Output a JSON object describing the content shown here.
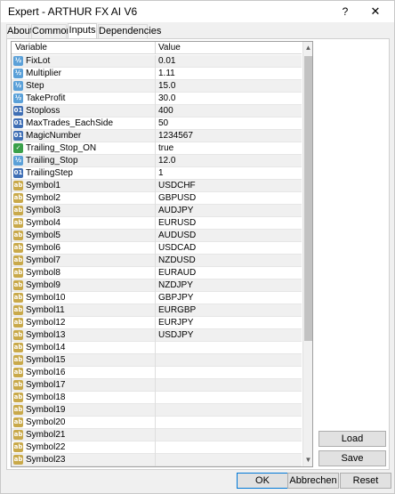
{
  "window": {
    "title": "Expert - ARTHUR FX AI V6",
    "help": "?",
    "close": "✕"
  },
  "tabs": [
    {
      "label": "About",
      "active": false
    },
    {
      "label": "Common",
      "active": false
    },
    {
      "label": "Inputs",
      "active": true
    },
    {
      "label": "Dependencies",
      "active": false
    }
  ],
  "grid": {
    "header_variable": "Variable",
    "header_value": "Value",
    "rows": [
      {
        "name": "FixLot",
        "value": "0.01",
        "type": "double"
      },
      {
        "name": "Multiplier",
        "value": "1.11",
        "type": "double"
      },
      {
        "name": "Step",
        "value": "15.0",
        "type": "double"
      },
      {
        "name": "TakeProfit",
        "value": "30.0",
        "type": "double"
      },
      {
        "name": "Stoploss",
        "value": "400",
        "type": "int"
      },
      {
        "name": "MaxTrades_EachSide",
        "value": "50",
        "type": "int"
      },
      {
        "name": "MagicNumber",
        "value": "1234567",
        "type": "int"
      },
      {
        "name": "Trailing_Stop_ON",
        "value": "true",
        "type": "bool"
      },
      {
        "name": "Trailing_Stop",
        "value": "12.0",
        "type": "double"
      },
      {
        "name": "TrailingStep",
        "value": "1",
        "type": "int"
      },
      {
        "name": "Symbol1",
        "value": "USDCHF",
        "type": "string"
      },
      {
        "name": "Symbol2",
        "value": "GBPUSD",
        "type": "string"
      },
      {
        "name": "Symbol3",
        "value": "AUDJPY",
        "type": "string"
      },
      {
        "name": "Symbol4",
        "value": "EURUSD",
        "type": "string"
      },
      {
        "name": "Symbol5",
        "value": "AUDUSD",
        "type": "string"
      },
      {
        "name": "Symbol6",
        "value": "USDCAD",
        "type": "string"
      },
      {
        "name": "Symbol7",
        "value": "NZDUSD",
        "type": "string"
      },
      {
        "name": "Symbol8",
        "value": "EURAUD",
        "type": "string"
      },
      {
        "name": "Symbol9",
        "value": "NZDJPY",
        "type": "string"
      },
      {
        "name": "Symbol10",
        "value": "GBPJPY",
        "type": "string"
      },
      {
        "name": "Symbol11",
        "value": "EURGBP",
        "type": "string"
      },
      {
        "name": "Symbol12",
        "value": "EURJPY",
        "type": "string"
      },
      {
        "name": "Symbol13",
        "value": "USDJPY",
        "type": "string"
      },
      {
        "name": "Symbol14",
        "value": "",
        "type": "string"
      },
      {
        "name": "Symbol15",
        "value": "",
        "type": "string"
      },
      {
        "name": "Symbol16",
        "value": "",
        "type": "string"
      },
      {
        "name": "Symbol17",
        "value": "",
        "type": "string"
      },
      {
        "name": "Symbol18",
        "value": "",
        "type": "string"
      },
      {
        "name": "Symbol19",
        "value": "",
        "type": "string"
      },
      {
        "name": "Symbol20",
        "value": "",
        "type": "string"
      },
      {
        "name": "Symbol21",
        "value": "",
        "type": "string"
      },
      {
        "name": "Symbol22",
        "value": "",
        "type": "string"
      },
      {
        "name": "Symbol23",
        "value": "",
        "type": "string"
      }
    ]
  },
  "icons": {
    "double": "double-icon",
    "int": "int-icon",
    "bool": "bool-icon",
    "string": "string-icon"
  },
  "icon_glyphs": {
    "double": "½",
    "int": "01",
    "bool": "✓",
    "string": "ab"
  },
  "buttons": {
    "load": "Load",
    "save": "Save",
    "ok": "OK",
    "cancel": "Abbrechen",
    "reset": "Reset"
  },
  "colors": {
    "accent": "#0078d7",
    "scroll_thumb": "#c2c2c2"
  }
}
